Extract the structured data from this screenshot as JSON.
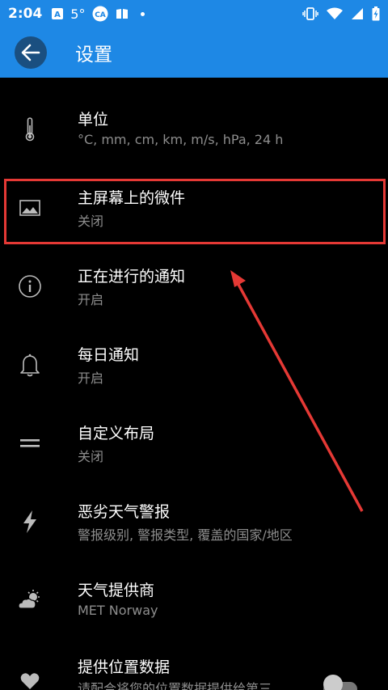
{
  "status_bar": {
    "time": "2:04",
    "temperature": "5°",
    "icons": [
      "a-icon",
      "cloud-badge-icon",
      "book-icon",
      "dot-icon",
      "vibrate-icon",
      "wifi-icon",
      "signal-icon",
      "battery-charging-icon"
    ]
  },
  "app_bar": {
    "title": "设置",
    "back_icon": "arrow-left-icon"
  },
  "settings": [
    {
      "label": "单位",
      "sub": "°C, mm, cm, km, m/s, hPa, 24 h",
      "icon": "thermometer-icon"
    },
    {
      "label": "主屏幕上的微件",
      "sub": "关闭",
      "icon": "image-icon"
    },
    {
      "label": "正在进行的通知",
      "sub": "开启",
      "icon": "info-icon"
    },
    {
      "label": "每日通知",
      "sub": "开启",
      "icon": "bell-icon"
    },
    {
      "label": "自定义布局",
      "sub": "关闭",
      "icon": "equals-icon"
    },
    {
      "label": "恶劣天气警报",
      "sub": "警报级别, 警报类型, 覆盖的国家/地区",
      "icon": "lightning-icon"
    },
    {
      "label": "天气提供商",
      "sub": "MET Norway",
      "icon": "partly-cloudy-icon"
    },
    {
      "label": "提供位置数据",
      "sub": "请配合将您的位置数据提供给第三",
      "icon": "heart-icon",
      "toggle": "off"
    }
  ],
  "colors": {
    "primary": "#1e88e5",
    "back_circle": "#1a4f80",
    "background": "#000000",
    "secondary_text": "#8d8d8d",
    "annotation": "#e53935"
  }
}
